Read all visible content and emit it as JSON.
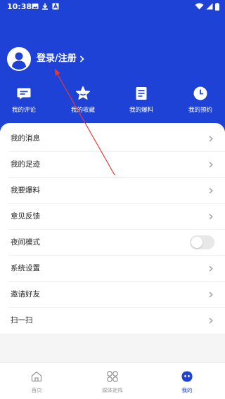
{
  "status_bar": {
    "time": "10:38",
    "left_icons": [
      "image-icon",
      "download-icon",
      "a-icon"
    ],
    "right_icons": [
      "wifi-icon",
      "signal-icon",
      "battery-icon"
    ]
  },
  "profile": {
    "avatar_icon": "user-avatar-icon",
    "login_label": "登录/注册"
  },
  "quick_actions": [
    {
      "label": "我的评论",
      "icon": "comment-icon"
    },
    {
      "label": "我的收藏",
      "icon": "star-icon"
    },
    {
      "label": "我的爆料",
      "icon": "report-icon"
    },
    {
      "label": "我的预约",
      "icon": "clock-icon"
    }
  ],
  "menu": [
    {
      "label": "我的消息"
    },
    {
      "label": "我的足迹"
    },
    {
      "label": "我要爆料"
    },
    {
      "label": "意见反馈"
    },
    {
      "label": "夜间模式",
      "toggle_on": false
    },
    {
      "label": "系统设置"
    },
    {
      "label": "邀请好友"
    },
    {
      "label": "扫一扫"
    }
  ],
  "tab_bar": [
    {
      "label": "首页",
      "icon": "home-icon",
      "active": false
    },
    {
      "label": "媒体矩阵",
      "icon": "grid-icon",
      "active": false
    },
    {
      "label": "我的",
      "icon": "face-icon",
      "active": true
    }
  ],
  "colors": {
    "primary": "#1e42d6",
    "annotation": "#e53935",
    "inactive": "#999999"
  }
}
